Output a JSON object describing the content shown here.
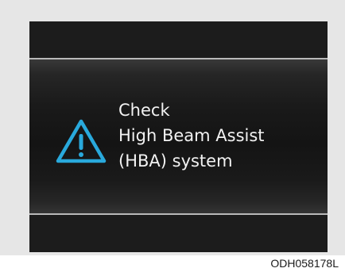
{
  "display": {
    "message_lines": [
      "Check",
      "High Beam Assist",
      "(HBA) system"
    ],
    "icon": "warning-triangle-icon",
    "icon_color": "#29a9dc",
    "text_color": "#f2f2f2",
    "screen_color": "#1c1c1c"
  },
  "figure": {
    "code": "ODH058178L"
  }
}
